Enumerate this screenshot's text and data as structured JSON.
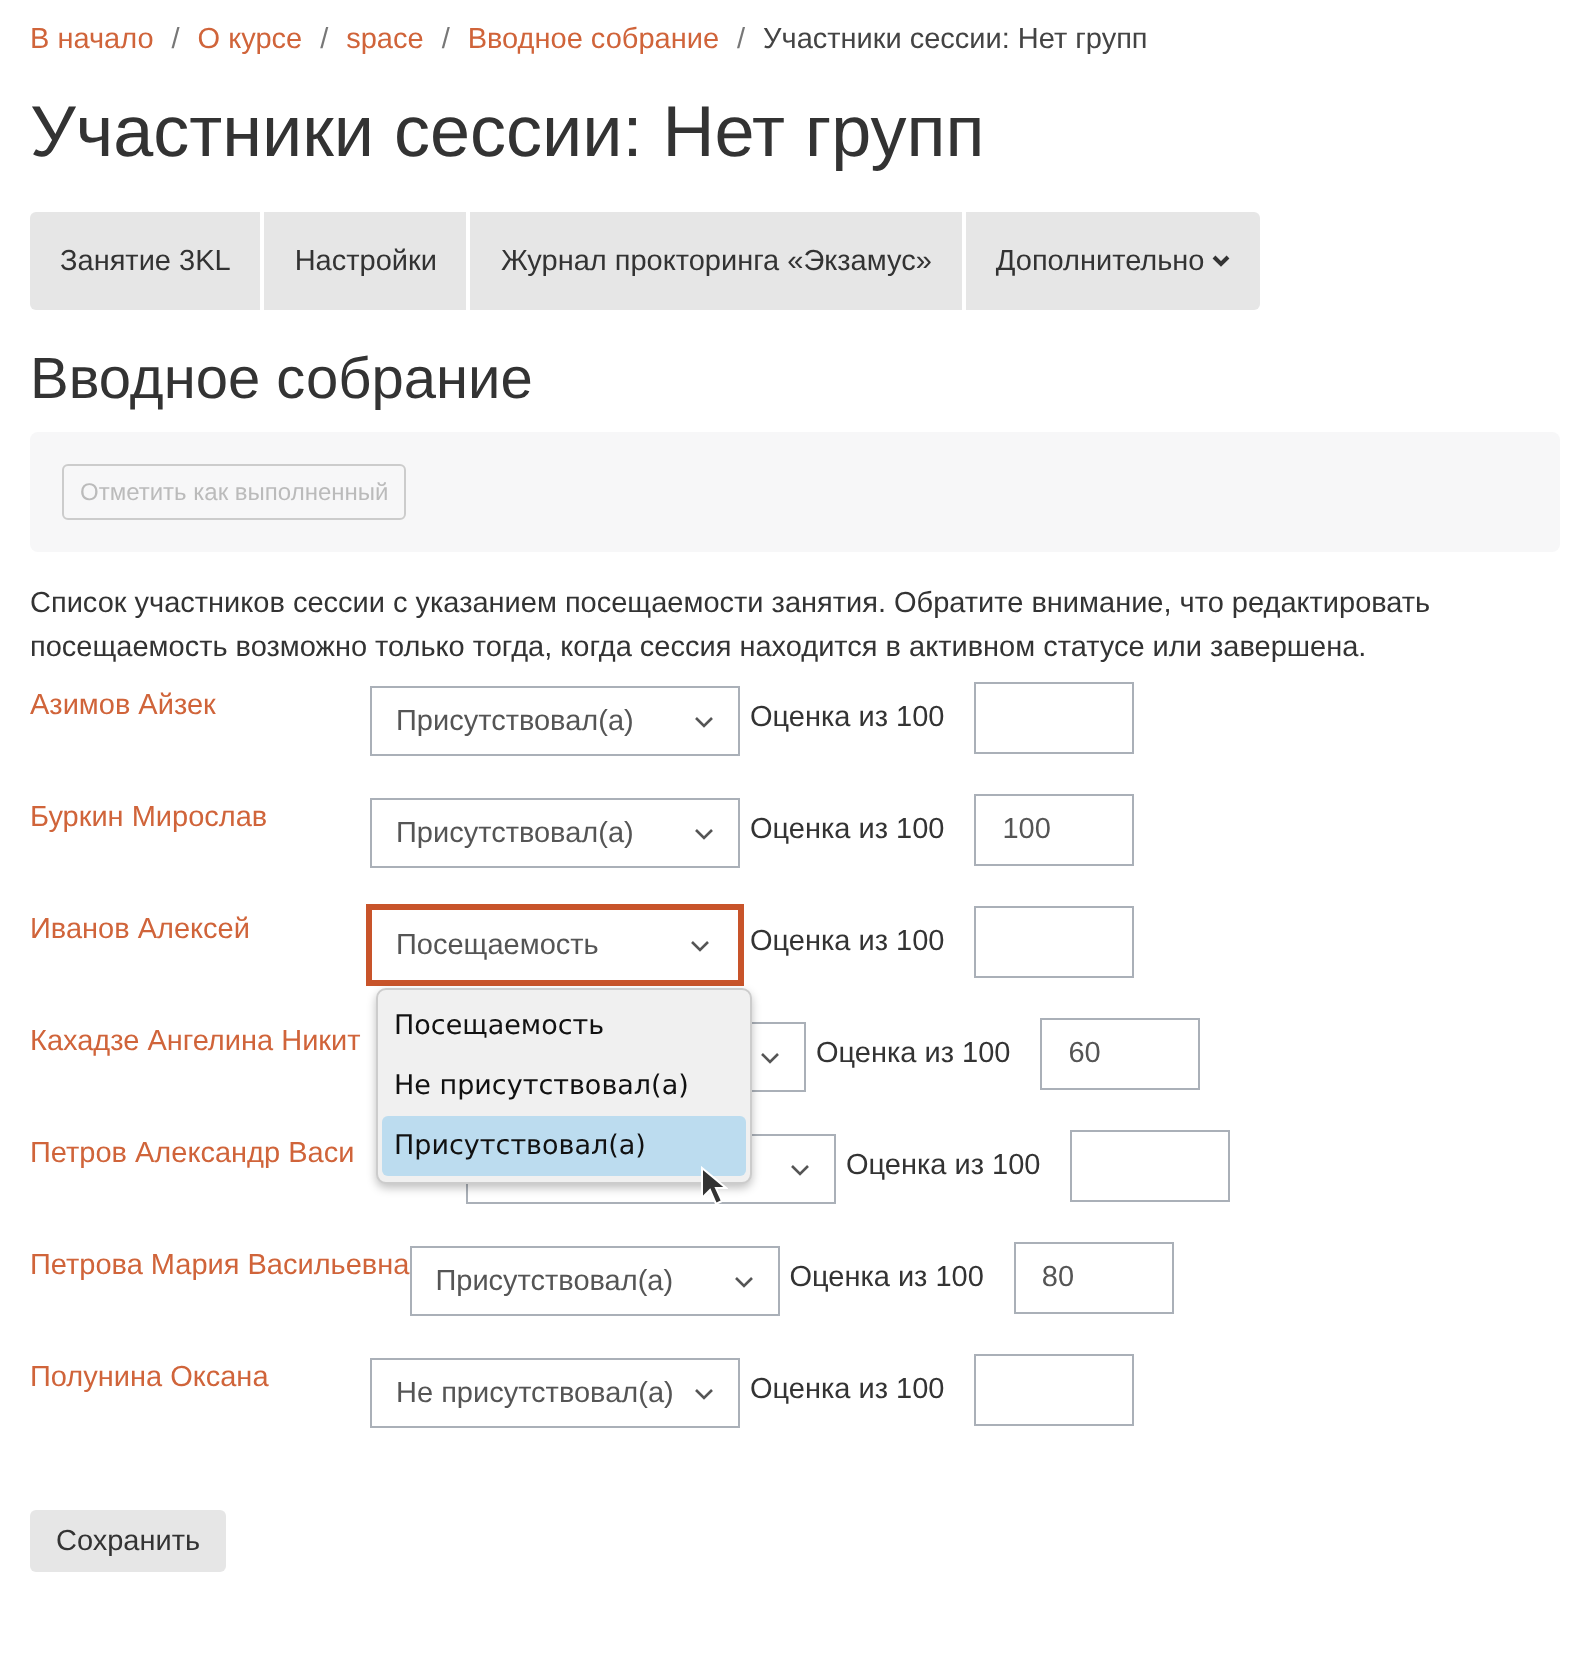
{
  "breadcrumbs": [
    {
      "label": "В начало",
      "link": true
    },
    {
      "separator": "/",
      "label": "О курсе",
      "link": true
    },
    {
      "separator": "/",
      "label": "space",
      "link": true
    },
    {
      "separator": "/",
      "label": "Вводное собрание",
      "link": true
    },
    {
      "separator": "/",
      "label": "Участники сессии: Нет групп",
      "link": false
    }
  ],
  "page_title": "Участники сессии: Нет групп",
  "nav_tabs": [
    {
      "label": "Занятие 3KL",
      "has_caret": false
    },
    {
      "label": "Настройки",
      "has_caret": false
    },
    {
      "label": "Журнал прокторинга «Экзамус»",
      "has_caret": false
    },
    {
      "label": "Дополнительно",
      "has_caret": true
    }
  ],
  "section_title": "Вводное собрание",
  "completion_button": {
    "label": "Отметить как выполненный",
    "disabled": true
  },
  "description": "Список участников сессии с указанием посещаемости занятия. Обратите внимание, что редактировать посещаемость возможно только тогда, когда сессия находится в активном статусе или завершена.",
  "participants": [
    {
      "name": "Азимов Айзек",
      "attendance": "Присутствовал(а)",
      "open": false,
      "score_label": "Оценка из 100"
    },
    {
      "name": "Буркин Мирослав",
      "attendance": "Присутствовал(а)",
      "open": false,
      "score_label": "Оценка из 100",
      "score": "100"
    },
    {
      "name": "Иванов Алексей",
      "attendance": "Посещаемость",
      "open": true,
      "score_label": "Оценка из 100",
      "options": [
        {
          "label": "Посещаемость",
          "selected": false
        },
        {
          "label": "Не присутствовал(а)",
          "selected": false
        },
        {
          "label": "Присутствовал(а)",
          "selected": true
        }
      ]
    },
    {
      "name": "Кахадзе Ангелина Никит",
      "open": false,
      "score_label": "Оценка из 100",
      "score": "60"
    },
    {
      "name": "Петров Александр Васи",
      "open": false,
      "score_label": "Оценка из 100"
    },
    {
      "name": "Петрова Мария Васильевна",
      "attendance": "Присутствовал(а)",
      "open": false,
      "score_label": "Оценка из 100",
      "score": "80"
    },
    {
      "name": "Полунина Оксана",
      "attendance": "Не присутствовал(а)",
      "open": false,
      "score_label": "Оценка из 100"
    }
  ],
  "save_button": "Сохранить"
}
